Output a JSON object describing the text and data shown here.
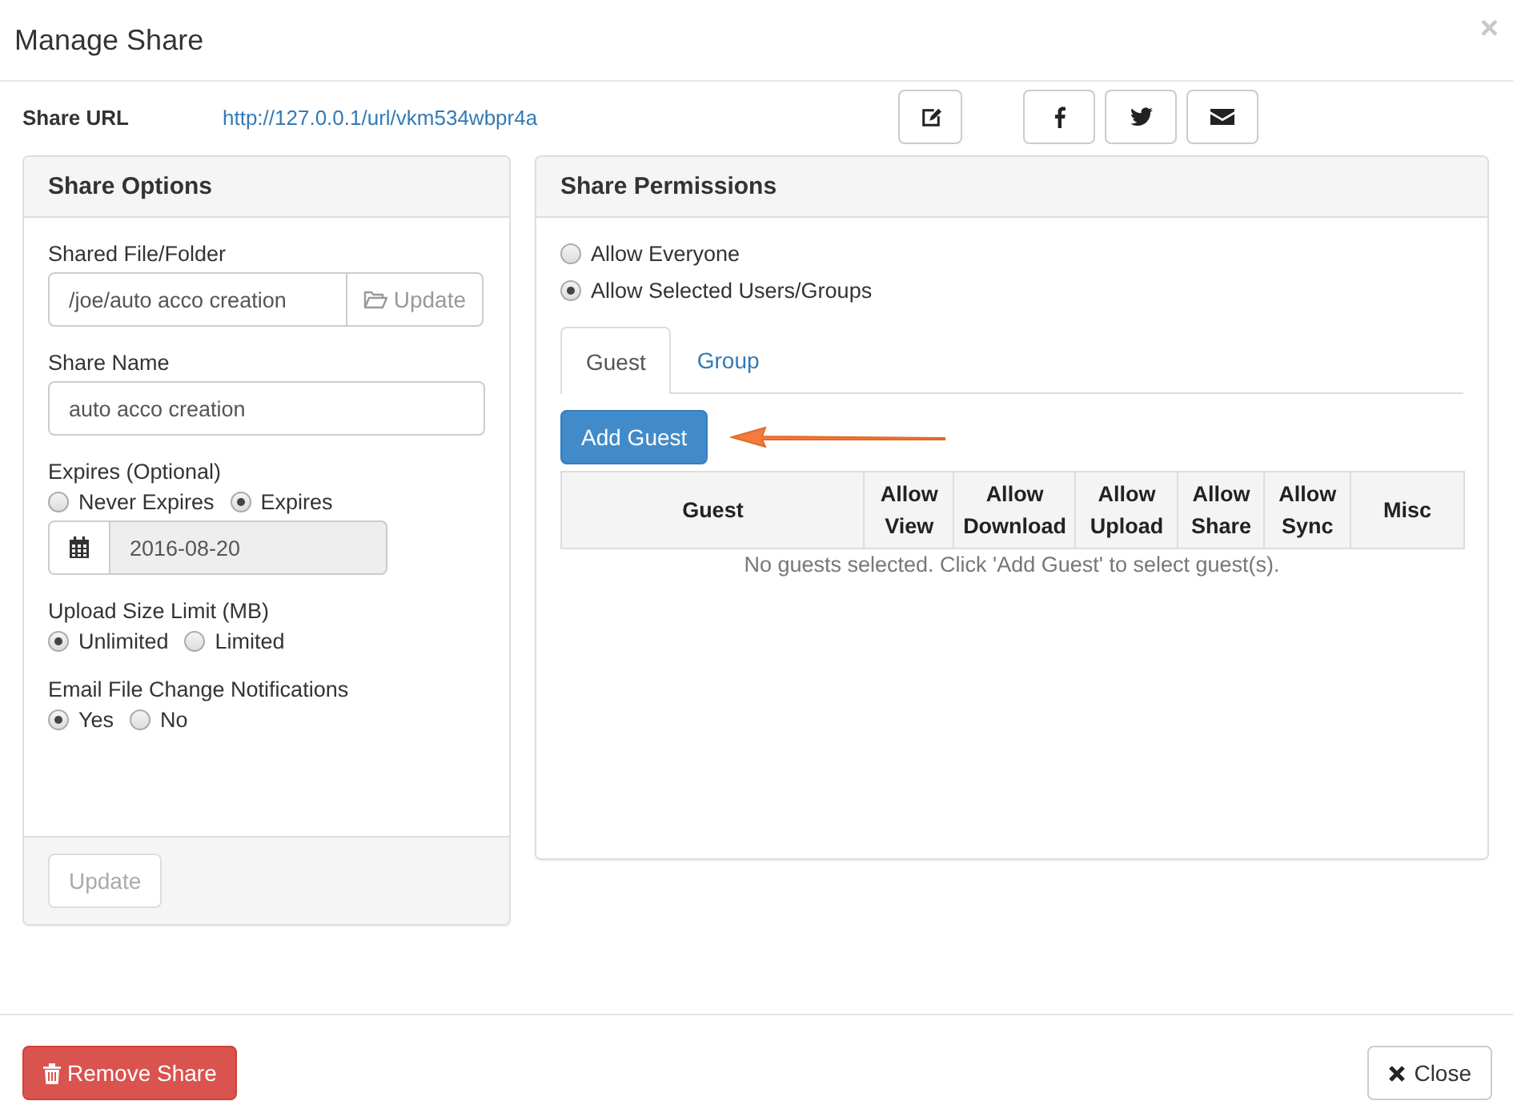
{
  "dialog": {
    "title": "Manage Share",
    "close": "×"
  },
  "share_url": {
    "label": "Share URL",
    "url": "http://127.0.0.1/url/vkm534wbpr4a"
  },
  "url_actions": [
    {
      "kind": "edit"
    },
    {
      "kind": "facebook"
    },
    {
      "kind": "twitter"
    },
    {
      "kind": "email"
    }
  ],
  "share_options": {
    "title": "Share Options",
    "fields": [
      {
        "kind": "path",
        "label": "Shared File/Folder",
        "value": "/joe/auto acco creation",
        "button": "Update"
      },
      {
        "kind": "text",
        "label": "Share Name",
        "value": "auto acco creation"
      },
      {
        "kind": "expiry",
        "label": "Expires (Optional)",
        "options": [
          {
            "label": "Never Expires",
            "selected": false
          },
          {
            "label": "Expires",
            "selected": true
          }
        ],
        "date": "2016-08-20"
      },
      {
        "kind": "choice",
        "label": "Upload Size Limit (MB)",
        "options": [
          {
            "label": "Unlimited",
            "selected": true
          },
          {
            "label": "Limited",
            "selected": false
          }
        ]
      },
      {
        "kind": "choice",
        "label": "Email File Change Notifications",
        "options": [
          {
            "label": "Yes",
            "selected": true
          },
          {
            "label": "No",
            "selected": false
          }
        ]
      }
    ],
    "update_button": {
      "label": "Update",
      "disabled": true
    }
  },
  "share_permissions": {
    "title": "Share Permissions",
    "access": [
      {
        "label": "Allow Everyone",
        "selected": false
      },
      {
        "label": "Allow Selected Users/Groups",
        "selected": true
      }
    ],
    "tabs": [
      {
        "label": "Guest",
        "selected": true
      },
      {
        "label": "Group",
        "selected": false
      }
    ],
    "add_button": "Add Guest",
    "table": {
      "columns": [
        "Guest",
        "Allow View",
        "Allow Download",
        "Allow Upload",
        "Allow Share",
        "Allow Sync",
        "Misc"
      ],
      "empty_message": "No guests selected. Click 'Add Guest' to select guest(s)."
    }
  },
  "footer": {
    "remove_button": "Remove Share",
    "close_button": "Close"
  }
}
